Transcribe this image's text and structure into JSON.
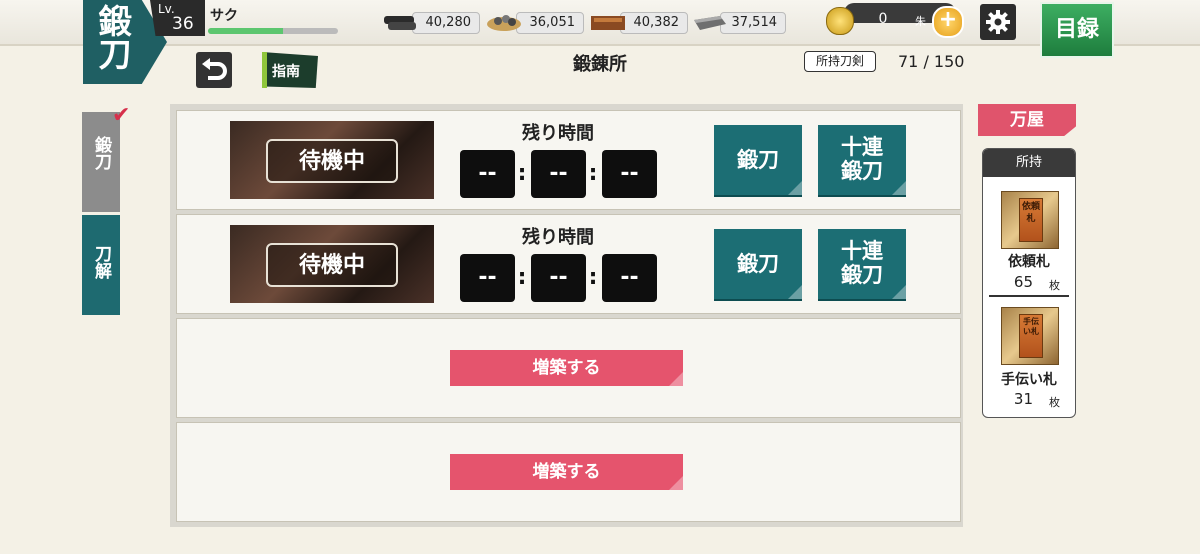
{
  "header": {
    "logo_text": "鍛刀",
    "level_label": "Lv.",
    "level": "36",
    "player_name": "サク",
    "xp_progress": 0.58,
    "resources": [
      {
        "icon": "charcoal-icon",
        "value": "40,280"
      },
      {
        "icon": "steel-icon",
        "value": "36,051"
      },
      {
        "icon": "coolant-icon",
        "value": "40,382"
      },
      {
        "icon": "whetstone-icon",
        "value": "37,514"
      }
    ],
    "coin": {
      "value": "0",
      "unit": "朱",
      "plus": "+"
    },
    "menu_label": "目録"
  },
  "subheader": {
    "guide_label": "指南",
    "title": "鍛錬所",
    "owned_label": "所持刀剣",
    "owned_value": "71 / 150"
  },
  "side_tabs": [
    {
      "label": "鍛刀",
      "selected": true
    },
    {
      "label": "刀解",
      "selected": false
    }
  ],
  "slots": [
    {
      "status": "待機中",
      "timer_label": "残り時間",
      "timer": [
        "--",
        "--",
        "--"
      ],
      "forge_label": "鍛刀",
      "ten_label_1": "十連",
      "ten_label_2": "鍛刀"
    },
    {
      "status": "待機中",
      "timer_label": "残り時間",
      "timer": [
        "--",
        "--",
        "--"
      ],
      "forge_label": "鍛刀",
      "ten_label_1": "十連",
      "ten_label_2": "鍛刀"
    }
  ],
  "expand_slots": [
    {
      "label": "増築する"
    },
    {
      "label": "増築する"
    }
  ],
  "shop": {
    "tab_label": "万屋",
    "owned_header": "所持",
    "items": [
      {
        "icon": "request-card-icon",
        "card_text": "依頼札",
        "name": "依頼札",
        "count": "65",
        "unit": "枚"
      },
      {
        "icon": "helper-card-icon",
        "card_text": "手伝い札",
        "name": "手伝い札",
        "count": "31",
        "unit": "枚"
      }
    ]
  },
  "colors": {
    "teal": "#1c6e74",
    "pink": "#e5546d",
    "green": "#1e7d3d"
  }
}
